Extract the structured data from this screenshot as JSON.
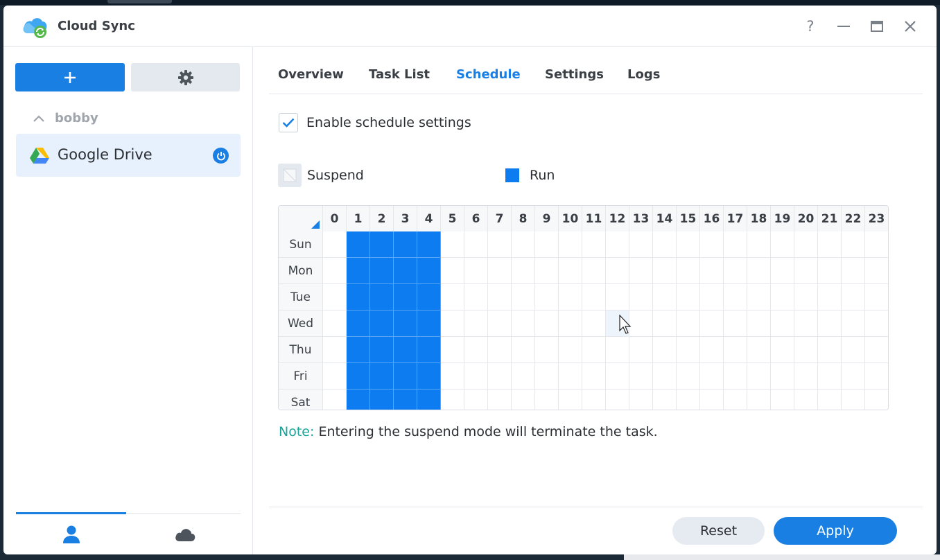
{
  "window": {
    "title": "Cloud Sync",
    "help_icon": "help-icon",
    "minimize_icon": "minimize-icon",
    "maximize_icon": "maximize-icon",
    "close_icon": "close-icon"
  },
  "sidebar": {
    "add_icon": "plus-icon",
    "settings_icon": "gear-icon",
    "group_label": "bobby",
    "items": [
      {
        "label": "Google Drive",
        "icon": "google-drive-icon",
        "status_icon": "power-icon"
      }
    ],
    "bottom_tabs": [
      {
        "icon": "user-icon",
        "active": true
      },
      {
        "icon": "cloud-icon",
        "active": false
      }
    ]
  },
  "tabs": [
    {
      "label": "Overview",
      "active": false
    },
    {
      "label": "Task List",
      "active": false
    },
    {
      "label": "Schedule",
      "active": true
    },
    {
      "label": "Settings",
      "active": false
    },
    {
      "label": "Logs",
      "active": false
    }
  ],
  "schedule": {
    "enable_label": "Enable schedule settings",
    "enabled": true,
    "legend_suspend": "Suspend",
    "legend_run": "Run",
    "hours": [
      "0",
      "1",
      "2",
      "3",
      "4",
      "5",
      "6",
      "7",
      "8",
      "9",
      "10",
      "11",
      "12",
      "13",
      "14",
      "15",
      "16",
      "17",
      "18",
      "19",
      "20",
      "21",
      "22",
      "23"
    ],
    "days": [
      "Sun",
      "Mon",
      "Tue",
      "Wed",
      "Thu",
      "Fri",
      "Sat"
    ],
    "run_hours": [
      1,
      2,
      3,
      4
    ],
    "note_key": "Note:",
    "note_text": "Entering the suspend mode will terminate the task."
  },
  "footer": {
    "reset_label": "Reset",
    "apply_label": "Apply"
  },
  "colors": {
    "accent": "#1a7fe3",
    "run": "#0c7cf0",
    "note": "#19a49a"
  }
}
